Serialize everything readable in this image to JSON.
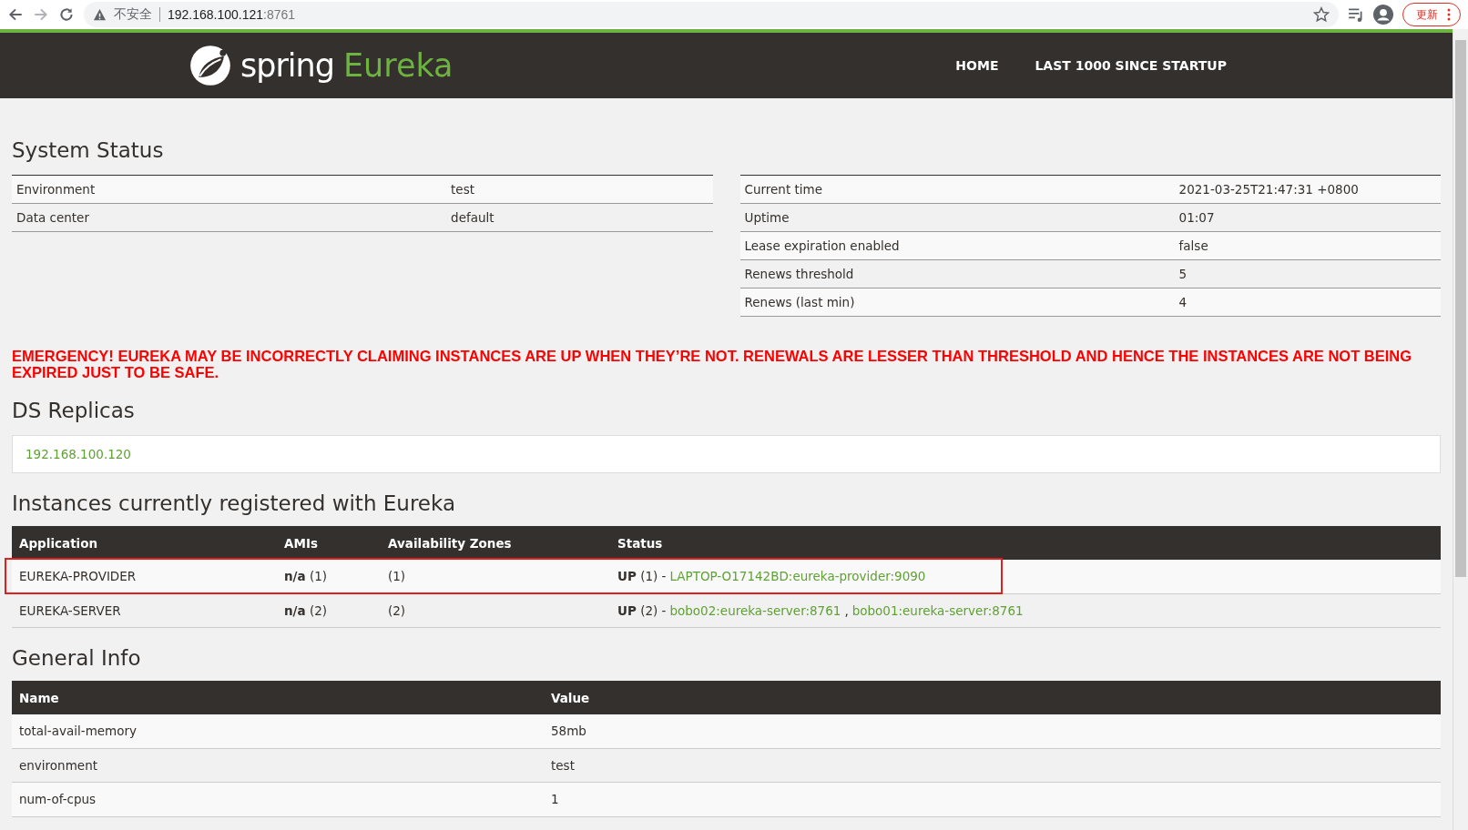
{
  "browser": {
    "security_label": "不安全",
    "url_host": "192.168.100.121",
    "url_port": ":8761",
    "update_button": "更新"
  },
  "header": {
    "logo_word": "spring",
    "logo_product": "Eureka",
    "nav": [
      {
        "label": "HOME"
      },
      {
        "label": "LAST 1000 SINCE STARTUP"
      }
    ]
  },
  "system_status": {
    "title": "System Status",
    "left_rows": [
      {
        "name": "Environment",
        "value": "test"
      },
      {
        "name": "Data center",
        "value": "default"
      }
    ],
    "right_rows": [
      {
        "name": "Current time",
        "value": "2021-03-25T21:47:31 +0800"
      },
      {
        "name": "Uptime",
        "value": "01:07"
      },
      {
        "name": "Lease expiration enabled",
        "value": "false"
      },
      {
        "name": "Renews threshold",
        "value": "5"
      },
      {
        "name": "Renews (last min)",
        "value": "4"
      }
    ]
  },
  "emergency_message": "EMERGENCY! EUREKA MAY BE INCORRECTLY CLAIMING INSTANCES ARE UP WHEN THEY’RE NOT. RENEWALS ARE LESSER THAN THRESHOLD AND HENCE THE INSTANCES ARE NOT BEING EXPIRED JUST TO BE SAFE.",
  "ds_replicas": {
    "title": "DS Replicas",
    "replicas": [
      "192.168.100.120"
    ]
  },
  "instances": {
    "title": "Instances currently registered with Eureka",
    "columns": [
      "Application",
      "AMIs",
      "Availability Zones",
      "Status"
    ],
    "rows": [
      {
        "application": "EUREKA-PROVIDER",
        "amis": "**n/a** (1)",
        "zones": "(1)",
        "status": "**UP** (1) -",
        "highlighted": true,
        "links": [
          {
            "kind": "link",
            "text": "LAPTOP-O17142BD:eureka-provider:9090"
          }
        ]
      },
      {
        "application": "EUREKA-SERVER",
        "amis": "**n/a** (2)",
        "zones": "(2)",
        "status": "**UP** (2) -",
        "highlighted": false,
        "links": [
          {
            "kind": "link",
            "text": "bobo02:eureka-server:8761"
          },
          {
            "kind": "text",
            "text": ","
          },
          {
            "kind": "link",
            "text": "bobo01:eureka-server:8761"
          }
        ]
      }
    ]
  },
  "general_info": {
    "title": "General Info",
    "columns": [
      "Name",
      "Value"
    ],
    "rows": [
      {
        "name": "total-avail-memory",
        "value": "58mb"
      },
      {
        "name": "environment",
        "value": "test"
      },
      {
        "name": "num-of-cpus",
        "value": "1"
      }
    ]
  }
}
